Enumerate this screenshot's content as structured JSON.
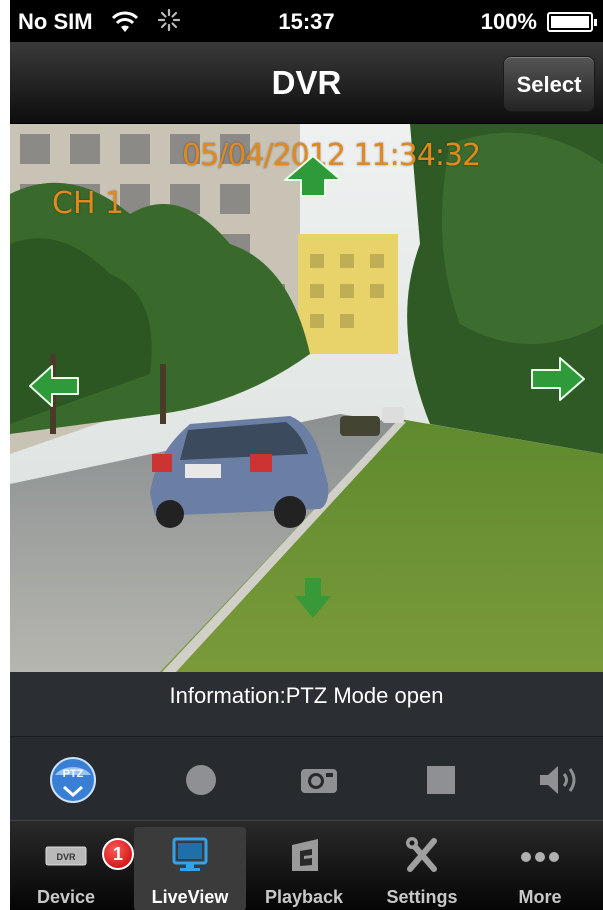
{
  "status_bar": {
    "carrier": "No SIM",
    "time": "15:37",
    "battery": "100%"
  },
  "nav": {
    "title": "DVR",
    "select_label": "Select"
  },
  "video": {
    "timestamp": "05/04/2012 11:34:32",
    "channel": "CH 1",
    "ptz_arrows": [
      "up-arrow-icon",
      "left-arrow-icon",
      "right-arrow-icon",
      "down-arrow-icon"
    ]
  },
  "info": {
    "text": "Information:PTZ Mode open"
  },
  "controls": [
    {
      "icon": "ptz-icon",
      "active": true
    },
    {
      "icon": "record-icon",
      "active": false
    },
    {
      "icon": "camera-snapshot-icon",
      "active": false
    },
    {
      "icon": "stop-icon",
      "active": false
    },
    {
      "icon": "speaker-icon",
      "active": false
    }
  ],
  "tabs": [
    {
      "label": "Device",
      "icon": "dvr-device-icon",
      "badge": "1"
    },
    {
      "label": "LiveView",
      "icon": "monitor-icon",
      "active": true
    },
    {
      "label": "Playback",
      "icon": "playback-icon"
    },
    {
      "label": "Settings",
      "icon": "settings-tools-icon"
    },
    {
      "label": "More",
      "icon": "more-dots-icon"
    }
  ],
  "colors": {
    "overlay_text": "#e0891f",
    "ptz_arrow": "#2e9a3a",
    "ptz_button": "#3a7fd6",
    "badge": "#d40000"
  }
}
